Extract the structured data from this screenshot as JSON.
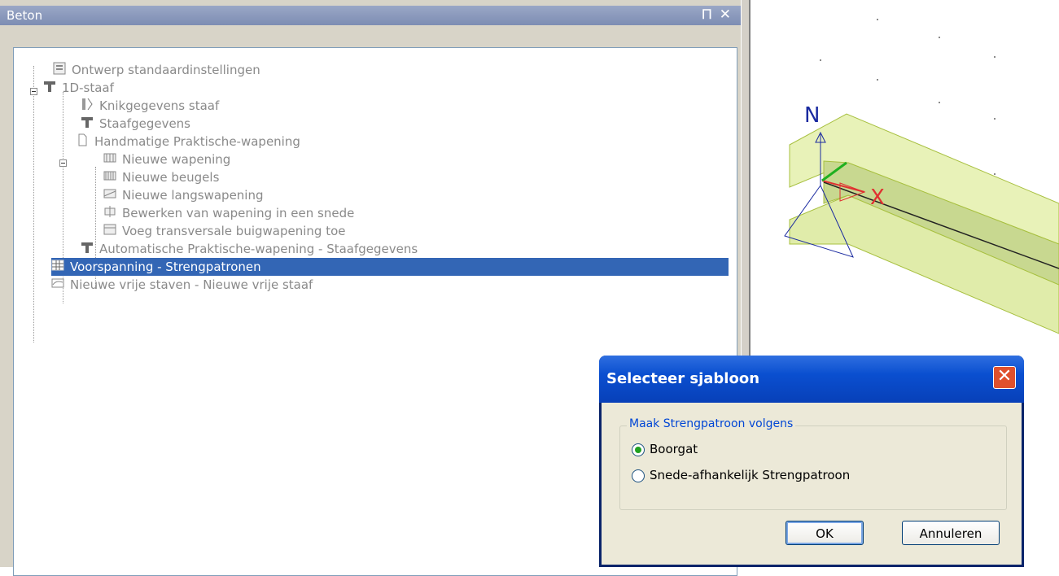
{
  "panel": {
    "title": "Beton",
    "pin_glyph": "⨅",
    "close_glyph": "✕"
  },
  "tree": {
    "items": [
      {
        "label": "Ontwerp standaardinstellingen",
        "icon": "settings-sheet-icon"
      },
      {
        "label": "1D-staaf",
        "icon": "beam-icon"
      },
      {
        "label": "Knikgegevens staaf",
        "icon": "buckling-icon"
      },
      {
        "label": "Staafgegevens",
        "icon": "beam-icon"
      },
      {
        "label": "Handmatige Praktische-wapening",
        "icon": "document-icon"
      },
      {
        "label": "Nieuwe wapening",
        "icon": "reinforcement-icon"
      },
      {
        "label": "Nieuwe beugels",
        "icon": "stirrups-icon"
      },
      {
        "label": "Nieuwe langswapening",
        "icon": "longitudinal-icon"
      },
      {
        "label": "Bewerken van wapening in een snede",
        "icon": "edit-section-icon"
      },
      {
        "label": "Voeg transversale buigwapening toe",
        "icon": "transverse-icon"
      },
      {
        "label": "Automatische Praktische-wapening - Staafgegevens",
        "icon": "beam-icon"
      },
      {
        "label": "Voorspanning - Strengpatronen",
        "icon": "grid-icon",
        "selected": true
      },
      {
        "label": "Nieuwe vrije staven - Nieuwe vrije staaf",
        "icon": "free-bar-icon"
      }
    ]
  },
  "view3d": {
    "axis_labels": {
      "z": "N",
      "x": "X"
    },
    "beam_color": "#e8f2b8",
    "axis_colors": {
      "z": "#1a2aa0",
      "x": "#e03030",
      "y": "#20b020"
    }
  },
  "dialog": {
    "title": "Selecteer sjabloon",
    "close_glyph": "✕",
    "group_label": "Maak Strengpatroon volgens",
    "options": [
      {
        "label": "Boorgat",
        "checked": true
      },
      {
        "label": "Snede-afhankelijk Strengpatroon",
        "checked": false
      }
    ],
    "ok_label": "OK",
    "cancel_label": "Annuleren"
  },
  "colors": {
    "selection": "#3366b5",
    "dialog_title": "#0a4fd0",
    "close_button": "#e0502c"
  }
}
